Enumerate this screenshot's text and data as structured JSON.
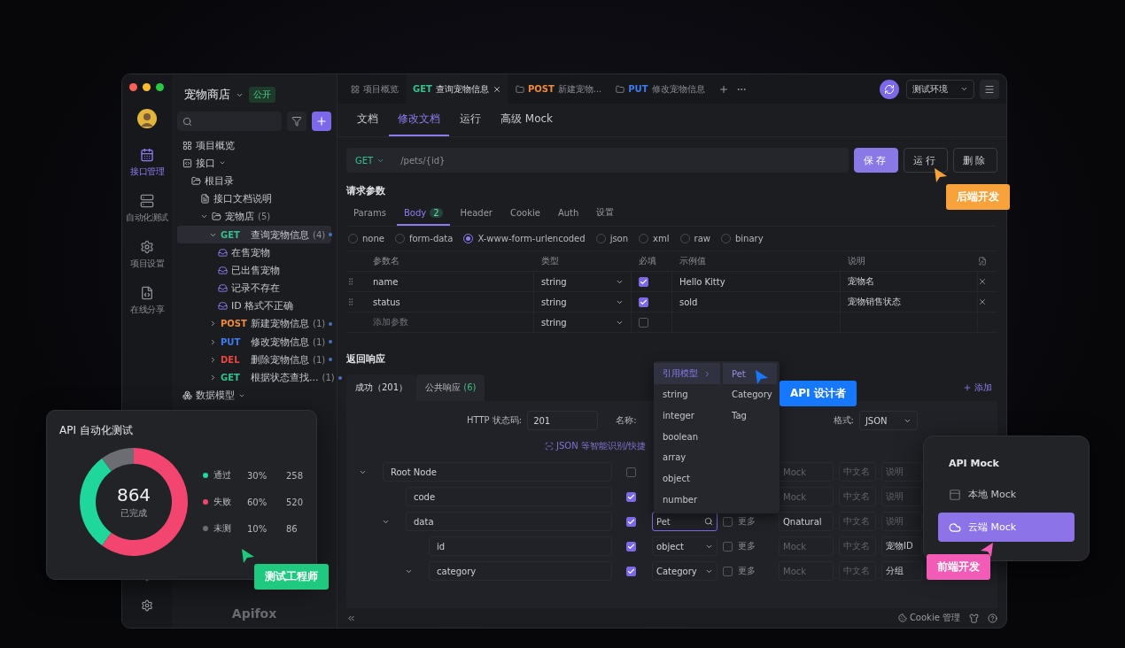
{
  "window": {
    "project": "宠物商店",
    "visibility": "公开"
  },
  "rail": {
    "items": [
      {
        "label": "接口管理",
        "selected": true
      },
      {
        "label": "自动化测试",
        "selected": false
      },
      {
        "label": "项目设置",
        "selected": false
      },
      {
        "label": "在线分享",
        "selected": false
      }
    ]
  },
  "sidebar": {
    "brand": "Apifox",
    "tree": [
      {
        "kind": "overview",
        "label": "项目概览",
        "selected": false
      },
      {
        "kind": "interfaces",
        "label": "接口",
        "selected": false,
        "children": [
          {
            "kind": "folder",
            "label": "根目录",
            "selected": false,
            "children": [
              {
                "kind": "doc",
                "label": "接口文档说明",
                "selected": false
              },
              {
                "kind": "folder",
                "label": "宠物店",
                "count": "(5)",
                "expanded": true,
                "selected": false,
                "children": [
                  {
                    "kind": "endpoint",
                    "method": "GET",
                    "color": "#33c08e",
                    "label": "查询宠物信息",
                    "count": "(4)",
                    "expanded": true,
                    "selected": true,
                    "children": [
                      {
                        "kind": "case",
                        "label": "在售宠物",
                        "selected": false
                      },
                      {
                        "kind": "case",
                        "label": "已出售宠物",
                        "selected": false
                      },
                      {
                        "kind": "case",
                        "label": "记录不存在",
                        "selected": false
                      },
                      {
                        "kind": "case",
                        "label": "ID 格式不正确",
                        "selected": false
                      }
                    ]
                  },
                  {
                    "kind": "endpoint",
                    "method": "POST",
                    "color": "#f08a3a",
                    "label": "新建宠物信息",
                    "count": "(1)",
                    "expanded": false,
                    "selected": false
                  },
                  {
                    "kind": "endpoint",
                    "method": "PUT",
                    "color": "#3d7cf0",
                    "label": "修改宠物信息",
                    "count": "(1)",
                    "expanded": false,
                    "selected": false
                  },
                  {
                    "kind": "endpoint",
                    "method": "DEL",
                    "color": "#e8483f",
                    "label": "删除宠物信息",
                    "count": "(1)",
                    "expanded": false,
                    "selected": false
                  },
                  {
                    "kind": "endpoint",
                    "method": "GET",
                    "color": "#33c08e",
                    "label": "根据状态查找...",
                    "count": "(1)",
                    "expanded": false,
                    "selected": false
                  }
                ]
              }
            ]
          }
        ]
      },
      {
        "kind": "models",
        "label": "数据模型",
        "selected": false
      }
    ]
  },
  "tabs": [
    {
      "kind": "overview",
      "label": "项目概览",
      "selected": false
    },
    {
      "kind": "endpoint",
      "method": "GET",
      "color": "#33c08e",
      "label": "查询宠物信息",
      "selected": true
    },
    {
      "kind": "folder",
      "method": "POST",
      "color": "#f08a3a",
      "label": "新建宠物...",
      "selected": false
    },
    {
      "kind": "folder",
      "method": "PUT",
      "color": "#3d7cf0",
      "label": "修改宠物信息",
      "selected": false
    }
  ],
  "environment": "测试环境",
  "doc_tabs": [
    {
      "label": "文档",
      "selected": false
    },
    {
      "label": "修改文档",
      "selected": true
    },
    {
      "label": "运行",
      "selected": false
    },
    {
      "label": "高级 Mock",
      "selected": false
    }
  ],
  "request": {
    "method": "GET",
    "path": "/pets/{id}",
    "actions": [
      {
        "label": "保存",
        "kind": "primary"
      },
      {
        "label": "运行",
        "kind": "default"
      },
      {
        "label": "删除",
        "kind": "default"
      }
    ]
  },
  "params": {
    "title": "请求参数",
    "tabs": [
      {
        "label": "Params",
        "selected": false
      },
      {
        "label": "Body",
        "badge": "2",
        "selected": true
      },
      {
        "label": "Header",
        "selected": false
      },
      {
        "label": "Cookie",
        "selected": false
      },
      {
        "label": "Auth",
        "selected": false
      },
      {
        "label": "设置",
        "selected": false
      }
    ],
    "body_types": [
      {
        "label": "none",
        "selected": false
      },
      {
        "label": "form-data",
        "selected": false
      },
      {
        "label": "X-www-form-urlencoded",
        "selected": true
      },
      {
        "label": "json",
        "selected": false
      },
      {
        "label": "xml",
        "selected": false
      },
      {
        "label": "raw",
        "selected": false
      },
      {
        "label": "binary",
        "selected": false
      }
    ],
    "columns": [
      "参数名",
      "类型",
      "必填",
      "示例值",
      "说明"
    ],
    "rows": [
      {
        "name": "name",
        "type": "string",
        "required": true,
        "example": "Hello Kitty",
        "description": "宠物名"
      },
      {
        "name": "status",
        "type": "string",
        "required": true,
        "example": "sold",
        "description": "宠物销售状态"
      }
    ],
    "new_row": {
      "placeholder": "添加参数",
      "type": "string",
      "required": false
    }
  },
  "response": {
    "title": "返回响应",
    "tabs": [
      {
        "label": "成功（201）",
        "selected": true
      },
      {
        "label": "公共响应",
        "badge": "(6)",
        "selected": false
      }
    ],
    "add": "添加",
    "status_label": "HTTP 状态码:",
    "status": "201",
    "name_label": "名称:",
    "format_label": "格式:",
    "format": "JSON",
    "smart_import": "JSON 等智能识别/快捷",
    "schema": [
      {
        "name": "Root Node",
        "expanded": true,
        "required": false,
        "mock_placeholder": "Mock",
        "cn_placeholder": "中文名",
        "desc_placeholder": "说明",
        "children": [
          {
            "name": "code",
            "required": true,
            "mock_placeholder": "Mock",
            "cn_placeholder": "中文名",
            "desc_placeholder": "说明"
          },
          {
            "name": "data",
            "expanded": true,
            "required": true,
            "type": {
              "kind": "search",
              "value": "Pet"
            },
            "nullable": false,
            "more": "更多",
            "mock": "Qnatural",
            "cn_placeholder": "中文名",
            "desc_placeholder": "说明",
            "children": [
              {
                "name": "id",
                "required": true,
                "type": {
                  "kind": "select",
                  "value": "object"
                },
                "nullable": false,
                "more": "更多",
                "mock_placeholder": "Mock",
                "cn_placeholder": "中文名",
                "description": "宠物ID"
              },
              {
                "name": "category",
                "expanded": true,
                "required": true,
                "type": {
                  "kind": "select",
                  "value": "Category"
                },
                "nullable": false,
                "more": "更多",
                "mock_placeholder": "Mock",
                "cn_placeholder": "中文名",
                "description": "分组"
              }
            ]
          }
        ]
      }
    ]
  },
  "type_menu": {
    "header": "引用模型",
    "model": "Pet",
    "types": [
      "string",
      "integer",
      "boolean",
      "array",
      "object",
      "number"
    ],
    "models": [
      "Category",
      "Tag"
    ]
  },
  "footer": {
    "cookie": "Cookie 管理"
  },
  "test_card": {
    "title": "API 自动化测试",
    "total": "864",
    "total_label": "已完成",
    "legend": [
      {
        "percent": "30%",
        "count": "258",
        "color": "#1fd69b"
      },
      {
        "percent": "60%",
        "count": "520",
        "color": "#f2456f"
      },
      {
        "percent": "10%",
        "count": "86",
        "color": "#6b6d73"
      }
    ],
    "chart_data": {
      "type": "donut",
      "categories": [
        "通过",
        "失败",
        "未测"
      ],
      "values": [
        30,
        60,
        10
      ]
    }
  },
  "mock_card": {
    "title": "API Mock",
    "items": [
      {
        "label": "本地 Mock",
        "selected": false
      },
      {
        "label": "云端 Mock",
        "selected": true
      }
    ]
  },
  "personas": [
    {
      "label": "后端开发",
      "color": "#f7a23b"
    },
    {
      "label": "API 设计者",
      "color": "#1677ff"
    },
    {
      "label": "测试工程师",
      "color": "#1fc97f"
    },
    {
      "label": "前端开发",
      "color": "#f25cb6"
    }
  ]
}
